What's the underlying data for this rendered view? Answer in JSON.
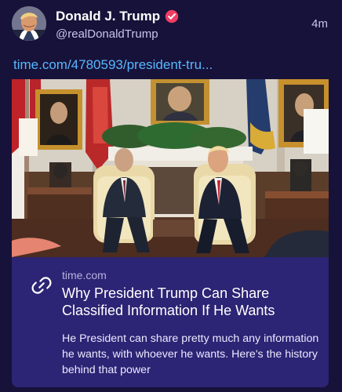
{
  "post": {
    "author": {
      "display_name": "Donald J. Trump",
      "handle": "@realDonaldTrump",
      "verified": true,
      "verified_icon": "verified-badge-icon",
      "avatar_description": "user-avatar"
    },
    "timestamp": "4m",
    "link_text": "time.com/4780593/president-tru...",
    "card": {
      "domain": "time.com",
      "title": "Why President Trump Can Share Classified Information If He Wants",
      "description": "He President can share pretty much any information he wants, with whoever he wants. Here's the history behind that power",
      "icon": "link-icon"
    }
  },
  "colors": {
    "background": "#17123a",
    "card": "#2c2474",
    "link": "#58b7ff",
    "verified": "#ef3d64",
    "muted_text": "#c9c4e8"
  }
}
